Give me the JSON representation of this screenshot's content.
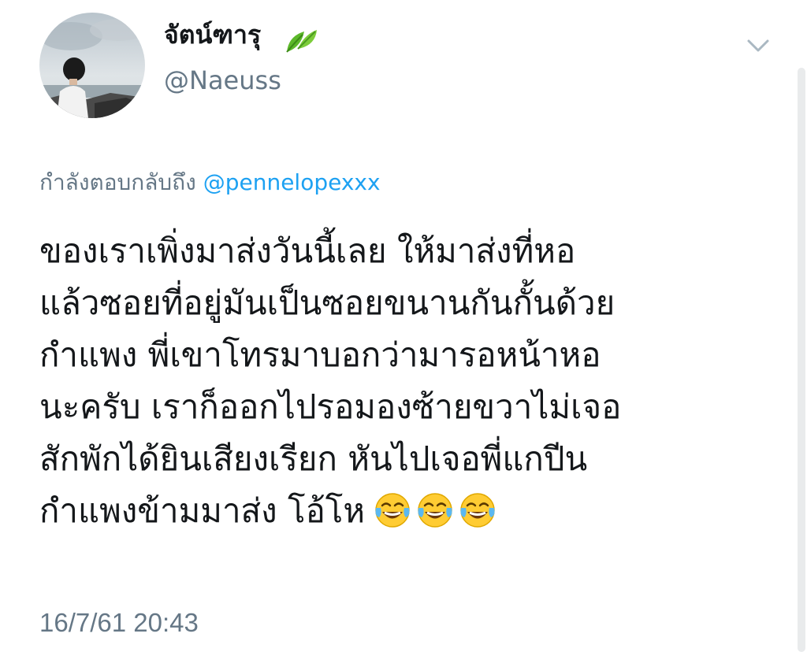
{
  "author": {
    "display_name": "จัตน์ฑารุ",
    "handle": "@Naeuss",
    "name_emoji": "leaf-icon",
    "avatar_icon": "avatar"
  },
  "tweet": {
    "reply_prefix": "กำลังตอบกลับถึง",
    "reply_to": "@pennelopexxx",
    "lines": [
      "ของเราเพิ่งมาส่งวันนี้เลย  ให้มาส่งที่หอ",
      "แล้วซอยที่อยู่มันเป็นซอยขนานกันกั้นด้วย",
      "กำแพง พี่เขาโทรมาบอกว่ามารอหน้าหอ",
      "นะครับ เราก็ออกไปรอมองซ้ายขวาไม่เจอ",
      "สักพักได้ยินเสียงเรียก หันไปเจอพี่แกปีน",
      "กำแพงข้ามมาส่ง โอ้โห"
    ],
    "trailing_emoji": [
      "face-with-tears-of-joy-icon",
      "face-with-tears-of-joy-icon",
      "face-with-tears-of-joy-icon"
    ],
    "timestamp": "16/7/61 20:43"
  },
  "controls": {
    "menu_icon": "chevron-down-icon"
  },
  "colors": {
    "text": "#14171a",
    "secondary": "#657786",
    "link": "#1da1f2"
  }
}
